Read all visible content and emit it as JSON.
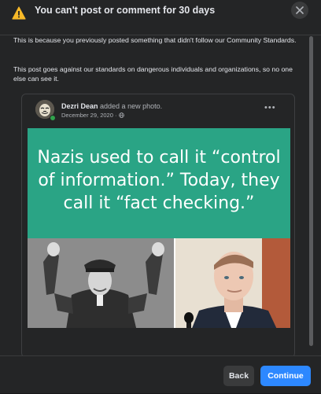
{
  "header": {
    "title": "You can't post or comment for 30 days",
    "warning_color": "#f7b928",
    "warning_icon": "warning-triangle",
    "close_icon": "x"
  },
  "body": {
    "paragraph1": "This is because you previously posted something that didn't follow our Community Standards.",
    "paragraph2": "This post goes against our standards on dangerous individuals and organizations, so no one else can see it."
  },
  "post": {
    "author": "Dezri Dean",
    "action": " added a new photo.",
    "date": "December 29, 2020",
    "separator": " · ",
    "privacy_icon": "globe",
    "more_label": "•••",
    "meme_text": "Nazis used to call it “control of information.” Today, they call it “fact checking.”",
    "meme_background": "#2aa485"
  },
  "footer": {
    "back_label": "Back",
    "continue_label": "Continue",
    "primary_color": "#2d88ff"
  }
}
